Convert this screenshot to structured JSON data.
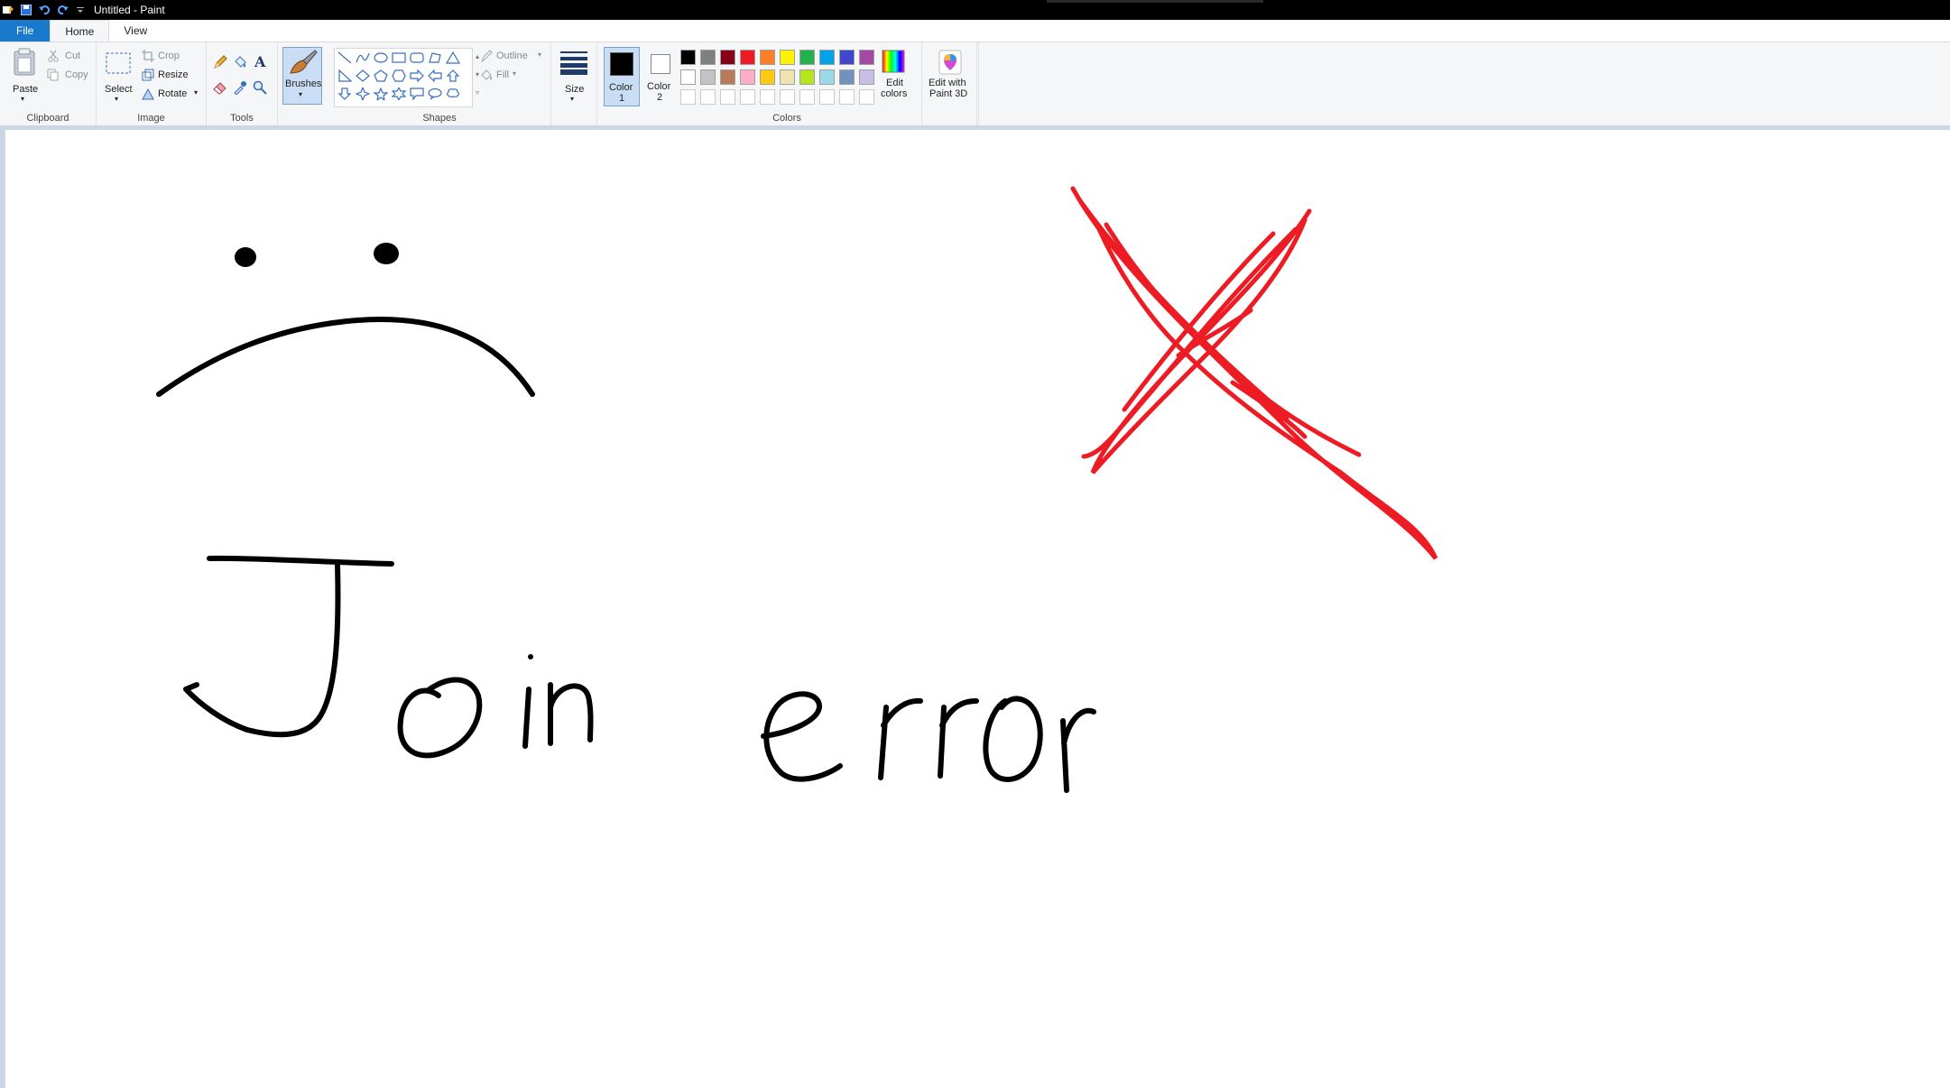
{
  "window": {
    "title": "Untitled - Paint"
  },
  "menu": {
    "file": "File",
    "home": "Home",
    "view": "View"
  },
  "clipboard": {
    "paste": "Paste",
    "cut": "Cut",
    "copy": "Copy",
    "group_label": "Clipboard"
  },
  "image": {
    "select": "Select",
    "crop": "Crop",
    "resize": "Resize",
    "rotate": "Rotate",
    "group_label": "Image"
  },
  "tools": {
    "group_label": "Tools",
    "brushes": "Brushes"
  },
  "shapes": {
    "outline": "Outline",
    "fill": "Fill",
    "group_label": "Shapes"
  },
  "size": {
    "label": "Size"
  },
  "colors": {
    "color1_line1": "Color",
    "color1_line2": "1",
    "color2_line1": "Color",
    "color2_line2": "2",
    "group_label": "Colors",
    "edit_line1": "Edit",
    "edit_line2": "colors",
    "paint3d_line1": "Edit with",
    "paint3d_line2": "Paint 3D",
    "color1_value": "#000000",
    "color2_value": "#ffffff",
    "palette_row1": [
      "#000000",
      "#7f7f7f",
      "#880015",
      "#ed1c24",
      "#ff7f27",
      "#fff200",
      "#22b14c",
      "#00a2e8",
      "#3f48cc",
      "#a349a4"
    ],
    "palette_row2": [
      "#ffffff",
      "#c3c3c3",
      "#b97a57",
      "#ffaec9",
      "#ffc90e",
      "#efe4b0",
      "#b5e61d",
      "#99d9ea",
      "#7092be",
      "#c8bfe7"
    ]
  },
  "drawing": {
    "ink_color": "#000000",
    "x_color": "#ed1c24"
  }
}
